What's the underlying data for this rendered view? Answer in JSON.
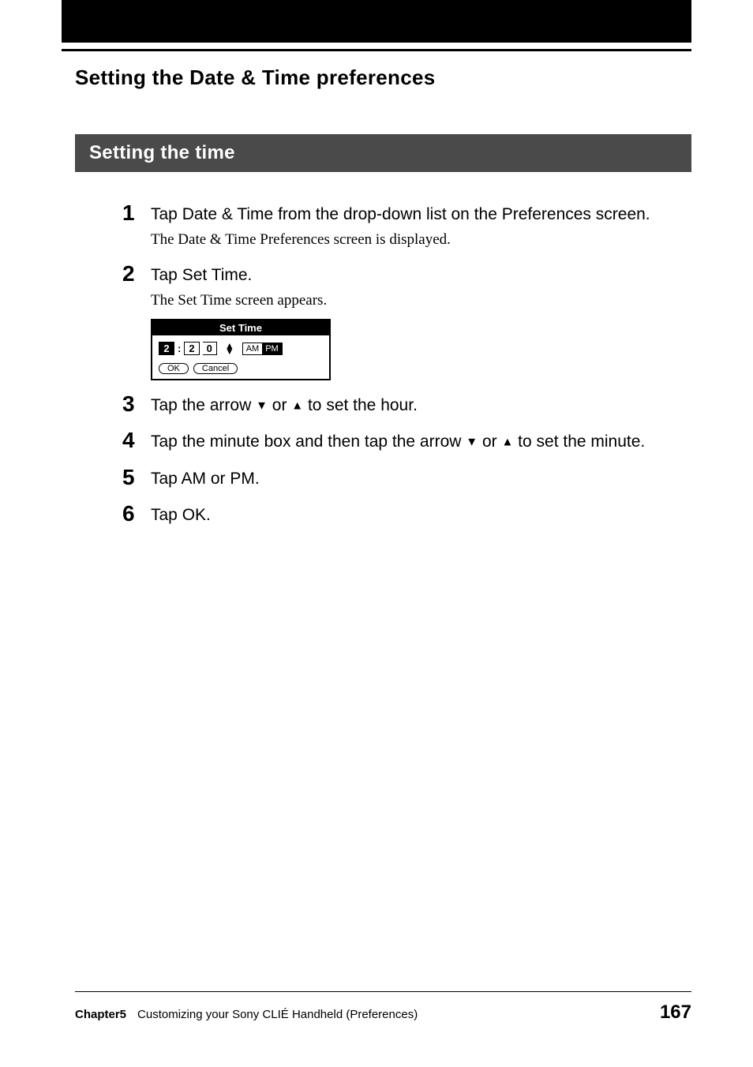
{
  "title": "Setting the Date & Time preferences",
  "section": "Setting the time",
  "steps": [
    {
      "num": "1",
      "main": "Tap Date & Time from the drop-down list on the Preferences screen.",
      "sub": "The Date & Time Preferences screen is displayed."
    },
    {
      "num": "2",
      "main": "Tap Set Time.",
      "sub": "The Set Time screen appears."
    },
    {
      "num": "3",
      "main_pre": "Tap the arrow ",
      "main_post": " to set the hour."
    },
    {
      "num": "4",
      "main_pre": "Tap the minute box and then tap the arrow ",
      "main_post": " to set the minute."
    },
    {
      "num": "5",
      "main": "Tap AM or PM."
    },
    {
      "num": "6",
      "main": "Tap OK."
    }
  ],
  "arrow_text": {
    "down": "▼",
    "or": " or ",
    "up": "▲"
  },
  "screenshot": {
    "title": "Set Time",
    "hour": "2",
    "min1": "2",
    "min2": "0",
    "am": "AM",
    "pm": "PM",
    "ok": "OK",
    "cancel": "Cancel"
  },
  "footer": {
    "chapter": "Chapter5",
    "desc": "Customizing your Sony CLIÉ Handheld (Preferences)",
    "page": "167"
  }
}
